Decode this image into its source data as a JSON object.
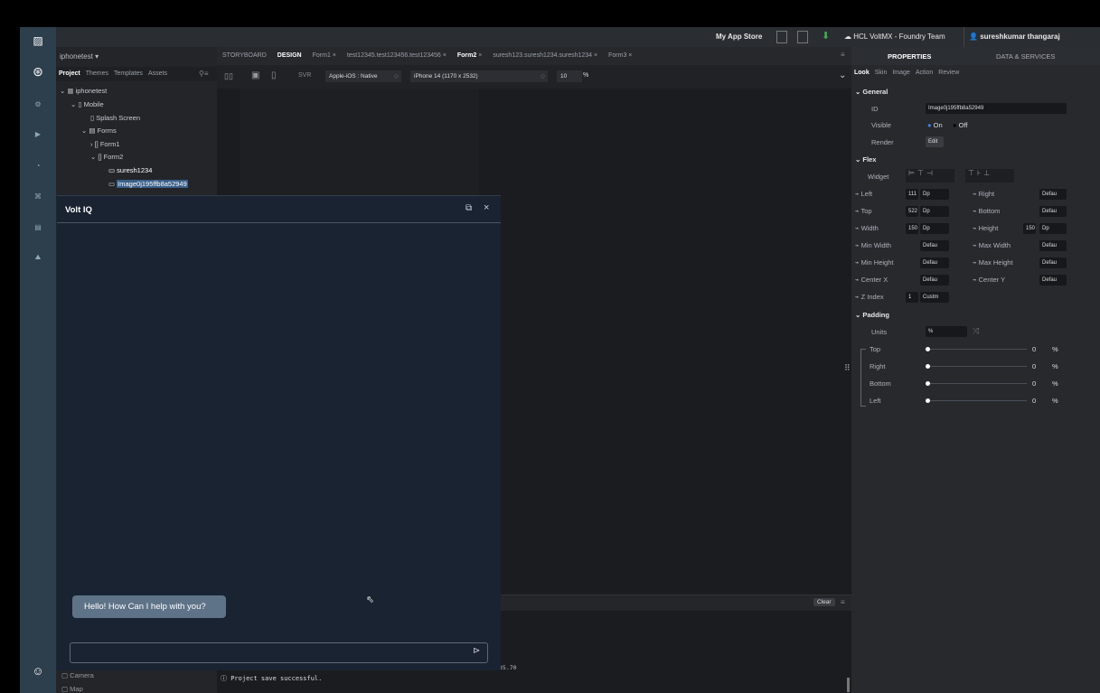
{
  "topbar": {
    "app_store": "My App Store",
    "cloud": "HCL VoltMX - Foundry Team",
    "user": "sureshkumar thangaraj"
  },
  "left": {
    "project_name": "iphonetest",
    "tabs": [
      "Project",
      "Themes",
      "Templates",
      "Assets"
    ],
    "tree": [
      "iphonetest",
      "Mobile",
      "Splash Screen",
      "Forms",
      "Form1",
      "Form2",
      "suresh1234",
      "Image0j195ffb8a52949"
    ],
    "bottom_items": [
      "Camera",
      "Map"
    ]
  },
  "center": {
    "tabs": [
      "STORYBOARD",
      "DESIGN",
      "Form1",
      "test12345.test123456.test123456",
      "Form2",
      "suresh123.suresh1234.suresh1234",
      "Form3"
    ],
    "platform": "Apple-iOS : Native",
    "device": "iPhone 14 (1170 x 2532)",
    "zoom": "10",
    "zoom_unit": "%",
    "svr": "SVR",
    "console_clear": "Clear",
    "console_msg": "Project save successful.",
    "console_num": "35.70"
  },
  "right": {
    "tabs": [
      "PROPERTIES",
      "DATA & SERVICES"
    ],
    "subtabs": [
      "Look",
      "Skin",
      "Image",
      "Action",
      "Review"
    ],
    "general": "General",
    "id_label": "ID",
    "id_value": "Image0j195ffb8a52949",
    "visible_label": "Visible",
    "on": "On",
    "off": "Off",
    "render_label": "Render",
    "edit": "Edit",
    "flex": "Flex",
    "widget_label": "Widget",
    "left_label": "Left",
    "left_val": "111",
    "top_label": "Top",
    "top_val": "522",
    "width_label": "Width",
    "width_val": "150",
    "height_label": "Height",
    "height_val": "150",
    "dp": "Dp",
    "right_label": "Right",
    "bottom_label": "Bottom",
    "minw": "Min Width",
    "maxw": "Max Width",
    "minh": "Min Height",
    "maxh": "Max Height",
    "cx": "Center X",
    "cy": "Center Y",
    "z": "Z Index",
    "z_val": "1",
    "custom": "Custm",
    "default": "Defau",
    "padding": "Padding",
    "units": "Units",
    "units_val": "%",
    "pad_top": "Top",
    "pad_right": "Right",
    "pad_bottom": "Bottom",
    "pad_left": "Left",
    "zero": "0",
    "pct": "%"
  },
  "chat": {
    "title": "Volt IQ",
    "greeting": "Hello! How Can I help with you?",
    "input_placeholder": ""
  }
}
